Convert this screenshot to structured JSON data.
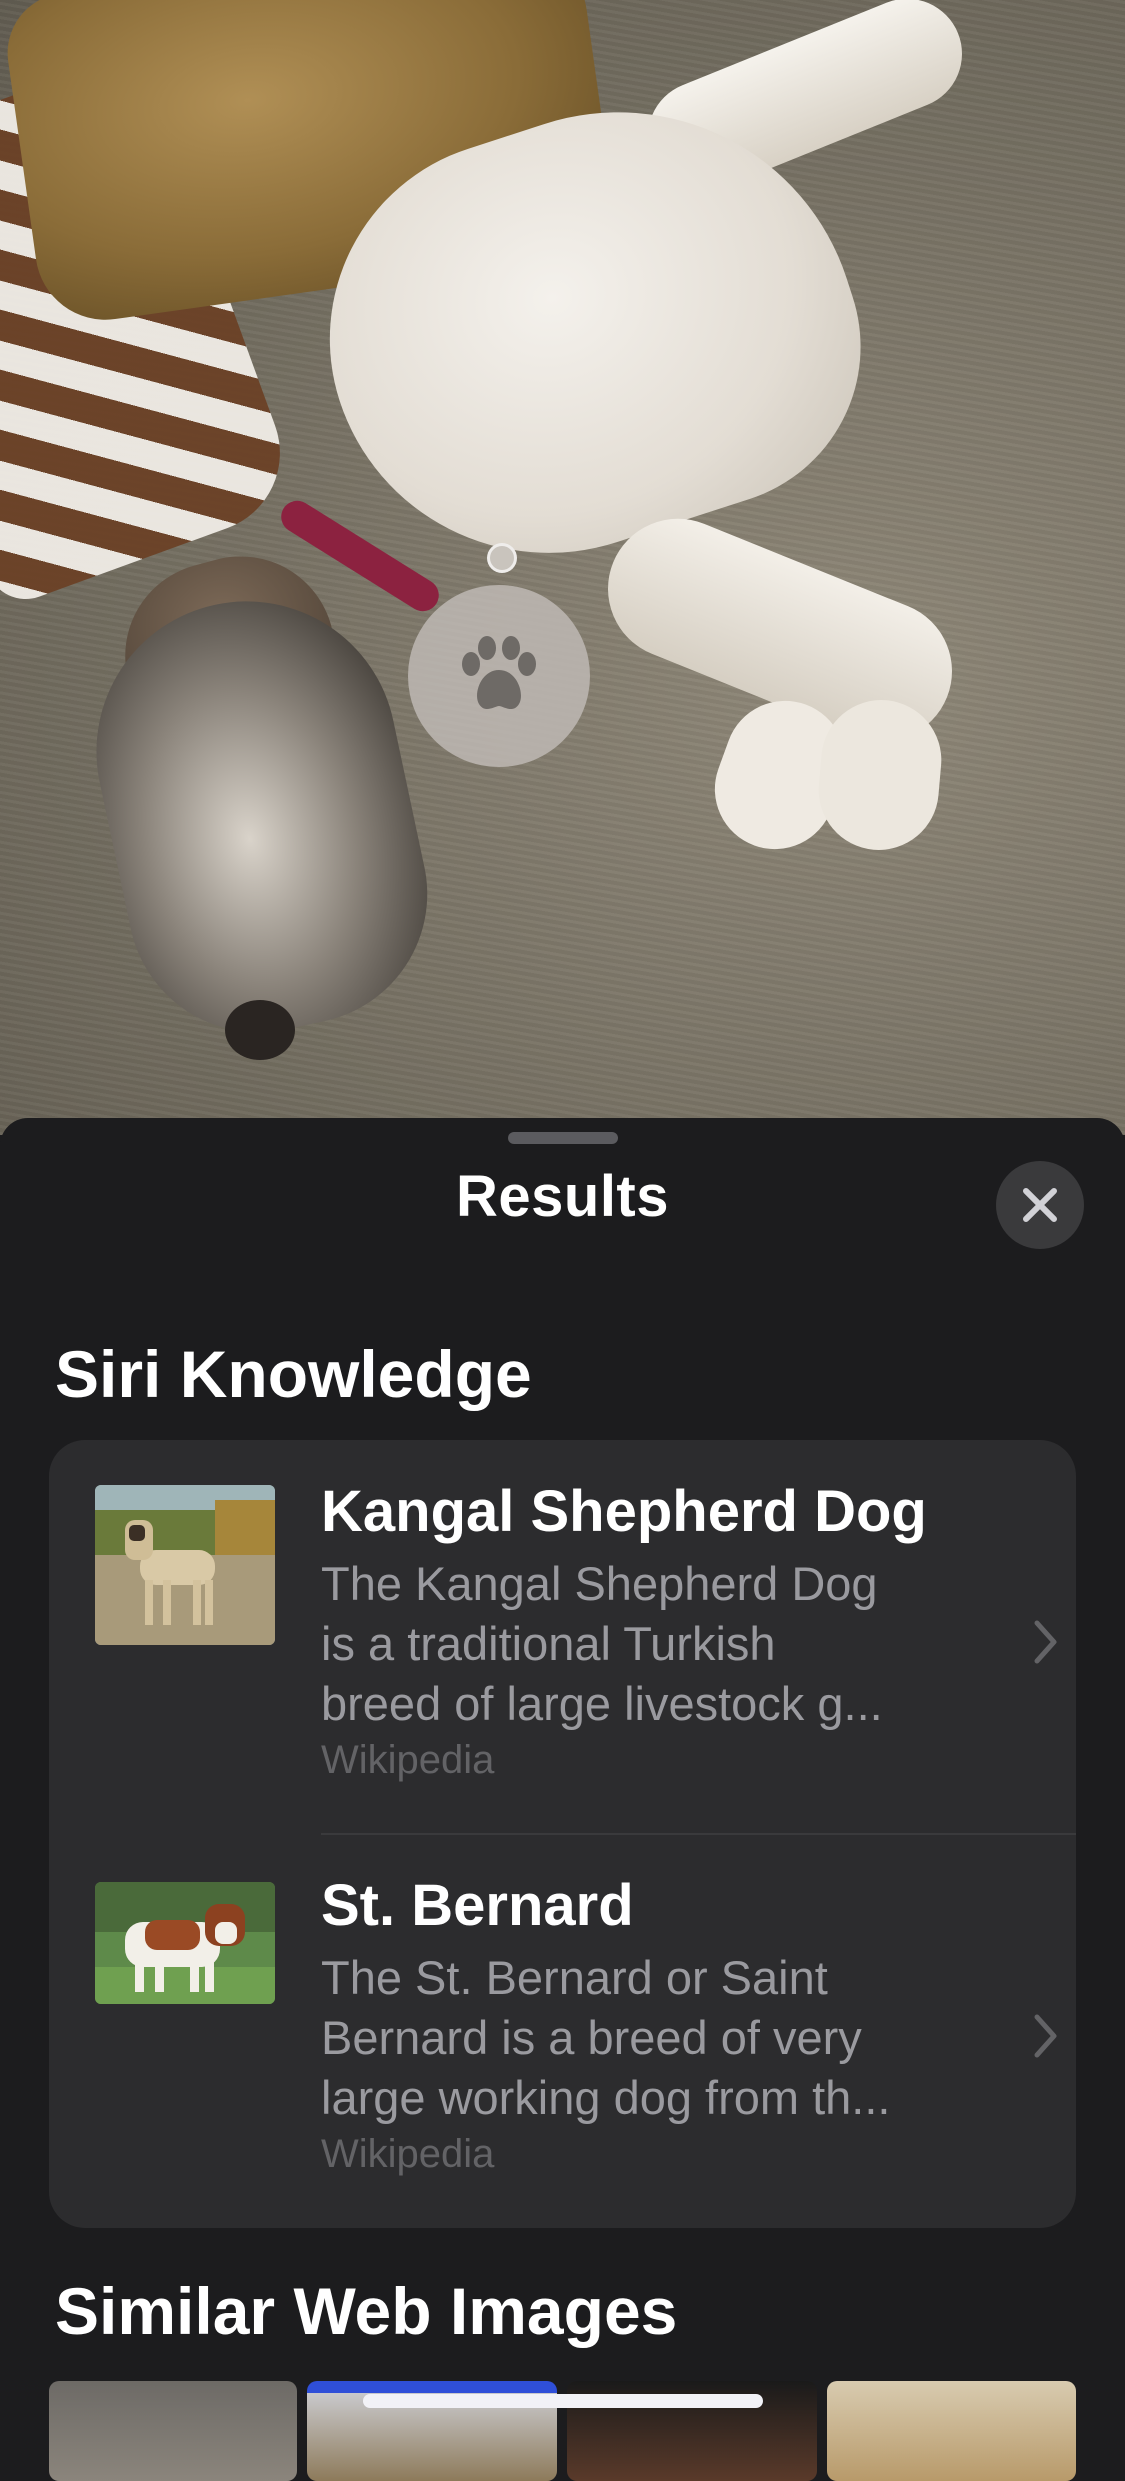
{
  "sheet": {
    "title": "Results",
    "close_icon": "close-icon"
  },
  "lookup": {
    "icon": "paw-icon"
  },
  "siri_knowledge": {
    "heading": "Siri Knowledge",
    "items": [
      {
        "title": "Kangal Shepherd Dog",
        "desc_lines": [
          "The Kangal Shepherd Dog",
          "is a traditional Turkish",
          "breed of large livestock g..."
        ],
        "source": "Wikipedia",
        "thumb_icon": "kangal-dog-photo"
      },
      {
        "title": "St. Bernard",
        "desc_lines": [
          "The St. Bernard or Saint",
          "Bernard is a breed of very",
          "large working dog from th..."
        ],
        "source": "Wikipedia",
        "thumb_icon": "st-bernard-photo"
      }
    ]
  },
  "similar_web_images": {
    "heading": "Similar Web Images"
  },
  "colors": {
    "sheet_bg": "#1c1c1e",
    "card_bg": "#2c2c2e",
    "secondary_text": "#9a9a9f",
    "tertiary_text": "#636366"
  }
}
